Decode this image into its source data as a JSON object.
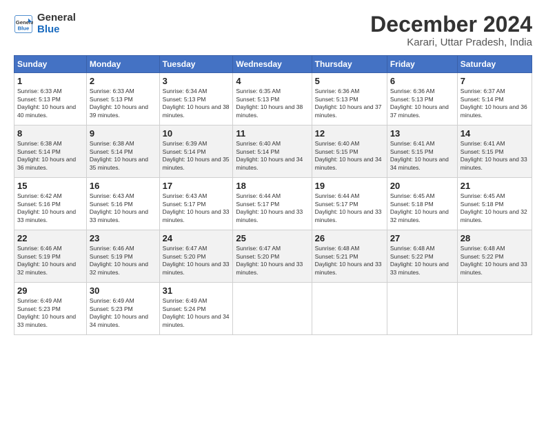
{
  "header": {
    "logo_line1": "General",
    "logo_line2": "Blue",
    "month_title": "December 2024",
    "subtitle": "Karari, Uttar Pradesh, India"
  },
  "columns": [
    "Sunday",
    "Monday",
    "Tuesday",
    "Wednesday",
    "Thursday",
    "Friday",
    "Saturday"
  ],
  "weeks": [
    [
      {
        "day": "1",
        "sunrise": "6:33 AM",
        "sunset": "5:13 PM",
        "daylight": "10 hours and 40 minutes."
      },
      {
        "day": "2",
        "sunrise": "6:33 AM",
        "sunset": "5:13 PM",
        "daylight": "10 hours and 39 minutes."
      },
      {
        "day": "3",
        "sunrise": "6:34 AM",
        "sunset": "5:13 PM",
        "daylight": "10 hours and 38 minutes."
      },
      {
        "day": "4",
        "sunrise": "6:35 AM",
        "sunset": "5:13 PM",
        "daylight": "10 hours and 38 minutes."
      },
      {
        "day": "5",
        "sunrise": "6:36 AM",
        "sunset": "5:13 PM",
        "daylight": "10 hours and 37 minutes."
      },
      {
        "day": "6",
        "sunrise": "6:36 AM",
        "sunset": "5:13 PM",
        "daylight": "10 hours and 37 minutes."
      },
      {
        "day": "7",
        "sunrise": "6:37 AM",
        "sunset": "5:14 PM",
        "daylight": "10 hours and 36 minutes."
      }
    ],
    [
      {
        "day": "8",
        "sunrise": "6:38 AM",
        "sunset": "5:14 PM",
        "daylight": "10 hours and 36 minutes."
      },
      {
        "day": "9",
        "sunrise": "6:38 AM",
        "sunset": "5:14 PM",
        "daylight": "10 hours and 35 minutes."
      },
      {
        "day": "10",
        "sunrise": "6:39 AM",
        "sunset": "5:14 PM",
        "daylight": "10 hours and 35 minutes."
      },
      {
        "day": "11",
        "sunrise": "6:40 AM",
        "sunset": "5:14 PM",
        "daylight": "10 hours and 34 minutes."
      },
      {
        "day": "12",
        "sunrise": "6:40 AM",
        "sunset": "5:15 PM",
        "daylight": "10 hours and 34 minutes."
      },
      {
        "day": "13",
        "sunrise": "6:41 AM",
        "sunset": "5:15 PM",
        "daylight": "10 hours and 34 minutes."
      },
      {
        "day": "14",
        "sunrise": "6:41 AM",
        "sunset": "5:15 PM",
        "daylight": "10 hours and 33 minutes."
      }
    ],
    [
      {
        "day": "15",
        "sunrise": "6:42 AM",
        "sunset": "5:16 PM",
        "daylight": "10 hours and 33 minutes."
      },
      {
        "day": "16",
        "sunrise": "6:43 AM",
        "sunset": "5:16 PM",
        "daylight": "10 hours and 33 minutes."
      },
      {
        "day": "17",
        "sunrise": "6:43 AM",
        "sunset": "5:17 PM",
        "daylight": "10 hours and 33 minutes."
      },
      {
        "day": "18",
        "sunrise": "6:44 AM",
        "sunset": "5:17 PM",
        "daylight": "10 hours and 33 minutes."
      },
      {
        "day": "19",
        "sunrise": "6:44 AM",
        "sunset": "5:17 PM",
        "daylight": "10 hours and 33 minutes."
      },
      {
        "day": "20",
        "sunrise": "6:45 AM",
        "sunset": "5:18 PM",
        "daylight": "10 hours and 32 minutes."
      },
      {
        "day": "21",
        "sunrise": "6:45 AM",
        "sunset": "5:18 PM",
        "daylight": "10 hours and 32 minutes."
      }
    ],
    [
      {
        "day": "22",
        "sunrise": "6:46 AM",
        "sunset": "5:19 PM",
        "daylight": "10 hours and 32 minutes."
      },
      {
        "day": "23",
        "sunrise": "6:46 AM",
        "sunset": "5:19 PM",
        "daylight": "10 hours and 32 minutes."
      },
      {
        "day": "24",
        "sunrise": "6:47 AM",
        "sunset": "5:20 PM",
        "daylight": "10 hours and 33 minutes."
      },
      {
        "day": "25",
        "sunrise": "6:47 AM",
        "sunset": "5:20 PM",
        "daylight": "10 hours and 33 minutes."
      },
      {
        "day": "26",
        "sunrise": "6:48 AM",
        "sunset": "5:21 PM",
        "daylight": "10 hours and 33 minutes."
      },
      {
        "day": "27",
        "sunrise": "6:48 AM",
        "sunset": "5:22 PM",
        "daylight": "10 hours and 33 minutes."
      },
      {
        "day": "28",
        "sunrise": "6:48 AM",
        "sunset": "5:22 PM",
        "daylight": "10 hours and 33 minutes."
      }
    ],
    [
      {
        "day": "29",
        "sunrise": "6:49 AM",
        "sunset": "5:23 PM",
        "daylight": "10 hours and 33 minutes."
      },
      {
        "day": "30",
        "sunrise": "6:49 AM",
        "sunset": "5:23 PM",
        "daylight": "10 hours and 34 minutes."
      },
      {
        "day": "31",
        "sunrise": "6:49 AM",
        "sunset": "5:24 PM",
        "daylight": "10 hours and 34 minutes."
      },
      null,
      null,
      null,
      null
    ]
  ],
  "labels": {
    "sunrise": "Sunrise: ",
    "sunset": "Sunset: ",
    "daylight": "Daylight: "
  }
}
